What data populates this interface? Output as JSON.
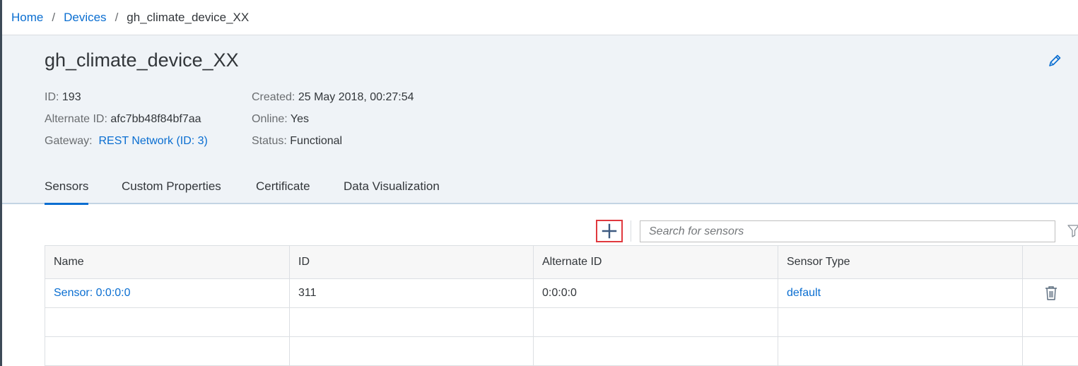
{
  "breadcrumb": {
    "home": "Home",
    "devices": "Devices",
    "current": "gh_climate_device_XX",
    "separator": "/"
  },
  "device": {
    "title": "gh_climate_device_XX",
    "id_label": "ID:",
    "id_value": "193",
    "alt_id_label": "Alternate ID:",
    "alt_id_value": "afc7bb48f84bf7aa",
    "gateway_label": "Gateway:",
    "gateway_value": "REST Network (ID: 3)",
    "created_label": "Created:",
    "created_value": "25 May 2018, 00:27:54",
    "online_label": "Online:",
    "online_value": "Yes",
    "status_label": "Status:",
    "status_value": "Functional"
  },
  "tabs": [
    {
      "label": "Sensors",
      "active": true
    },
    {
      "label": "Custom Properties",
      "active": false
    },
    {
      "label": "Certificate",
      "active": false
    },
    {
      "label": "Data Visualization",
      "active": false
    }
  ],
  "toolbar": {
    "search_placeholder": "Search for sensors"
  },
  "table": {
    "columns": [
      "Name",
      "ID",
      "Alternate ID",
      "Sensor Type"
    ],
    "rows": [
      {
        "name": "Sensor: 0:0:0:0",
        "id": "311",
        "alternate_id": "0:0:0:0",
        "sensor_type": "default"
      }
    ]
  },
  "icons": {
    "edit": "pencil-icon",
    "add": "plus-icon",
    "filter": "filter-icon",
    "delete": "trash-icon"
  },
  "colors": {
    "link": "#0a6ed1",
    "header_bg": "#eff3f7",
    "highlight": "#e0393e",
    "text": "#32363a"
  }
}
